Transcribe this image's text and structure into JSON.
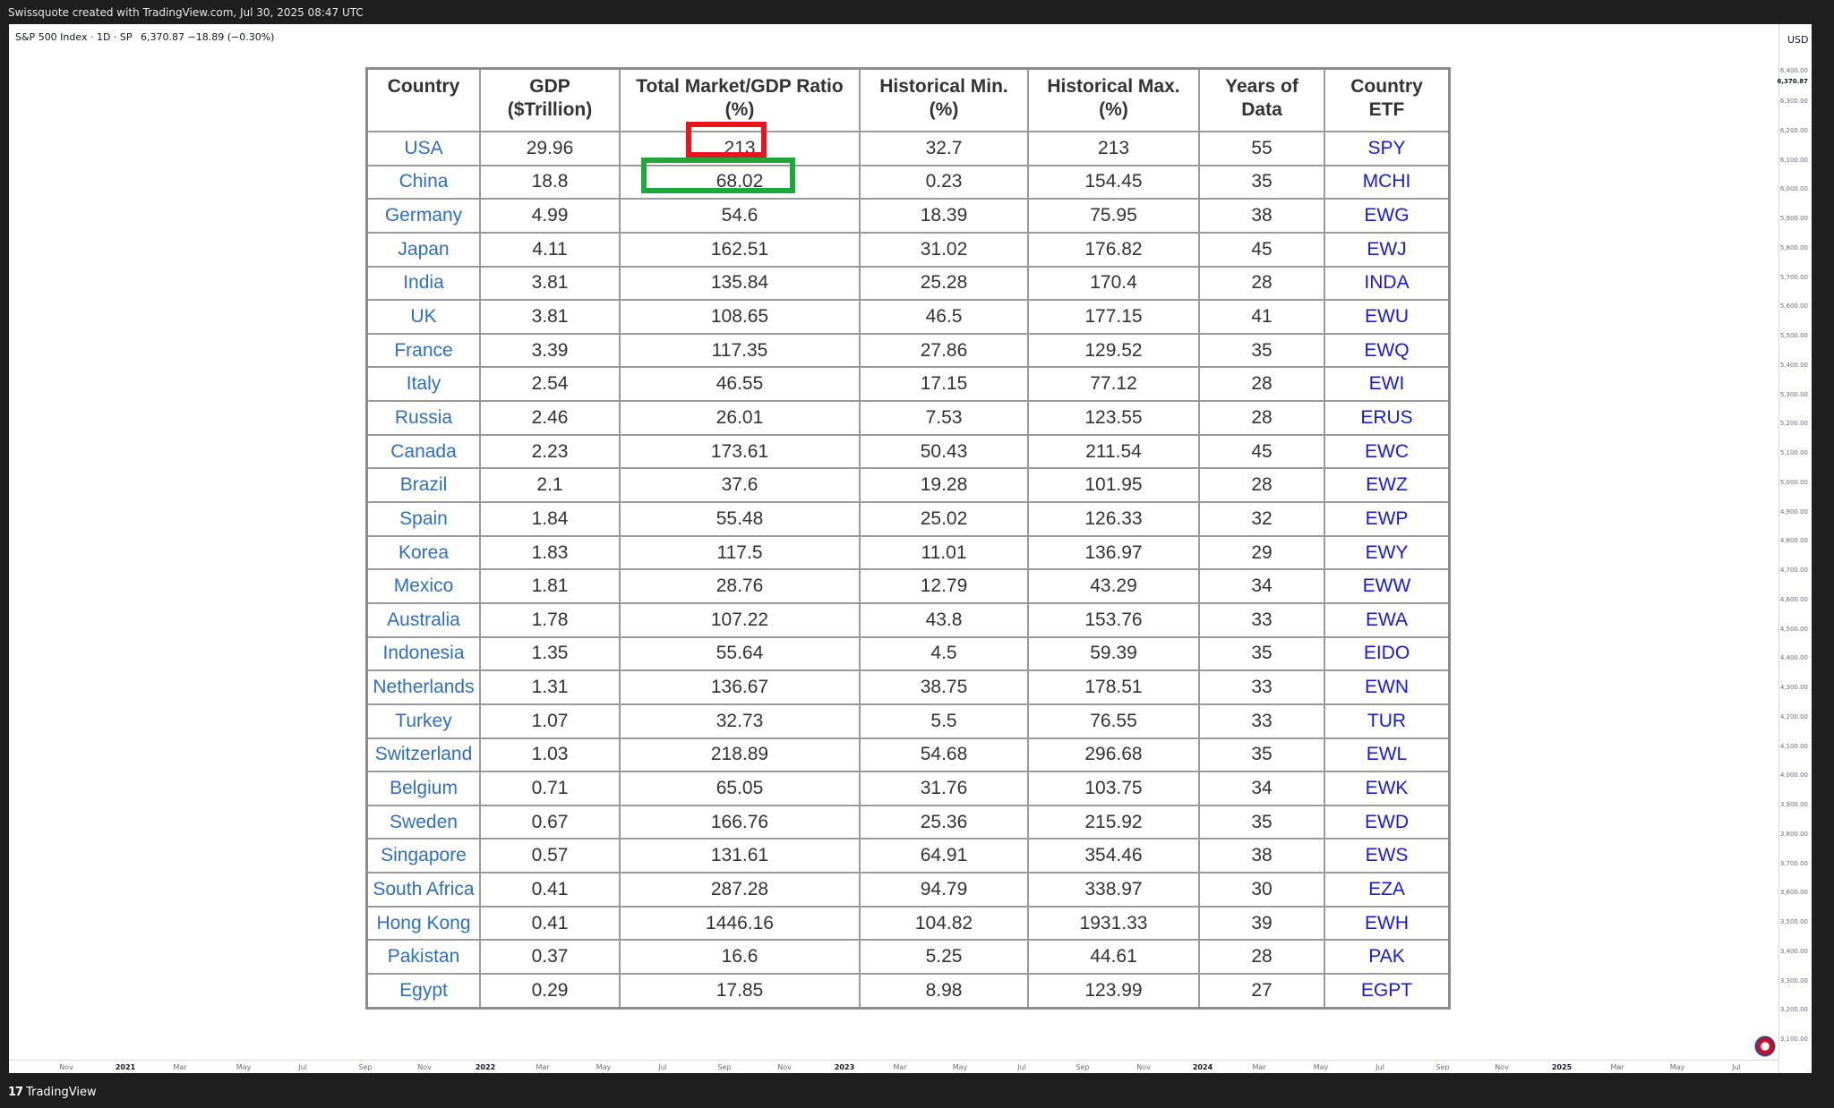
{
  "header": {
    "title": "Swissquote created with TradingView.com, Jul 30, 2025 08:47 UTC"
  },
  "symbol": {
    "name": "S&P 500 Index · 1D · SP",
    "price": "6,370.87",
    "change": "−18.89 (−0.30%)"
  },
  "currency": "USD",
  "price_scale": [
    "6,400.00",
    "6,370.87",
    "6,300.00",
    "6,200.00",
    "6,100.00",
    "6,000.00",
    "5,900.00",
    "5,800.00",
    "5,700.00",
    "5,600.00",
    "5,500.00",
    "5,400.00",
    "5,300.00",
    "5,200.00",
    "5,100.00",
    "5,000.00",
    "4,900.00",
    "4,800.00",
    "4,700.00",
    "4,600.00",
    "4,500.00",
    "4,400.00",
    "4,300.00",
    "4,200.00",
    "4,100.00",
    "4,000.00",
    "3,900.00",
    "3,800.00",
    "3,700.00",
    "3,600.00",
    "3,500.00",
    "3,400.00",
    "3,300.00",
    "3,200.00",
    "3,100.00"
  ],
  "time_axis": [
    "Nov",
    "2021",
    "Mar",
    "May",
    "Jul",
    "Sep",
    "Nov",
    "2022",
    "Mar",
    "May",
    "Jul",
    "Sep",
    "Nov",
    "2023",
    "Mar",
    "May",
    "Jul",
    "Sep",
    "Nov",
    "2024",
    "Mar",
    "May",
    "Jul",
    "Sep",
    "Nov",
    "2025",
    "Mar",
    "May",
    "Jul"
  ],
  "footer": {
    "brand": "TradingView",
    "brand_mark": "17"
  },
  "table": {
    "headers": [
      [
        "Country"
      ],
      [
        "GDP",
        "($Trillion)"
      ],
      [
        "Total Market/GDP Ratio",
        "(%)"
      ],
      [
        "Historical Min.",
        "(%)"
      ],
      [
        "Historical Max.",
        "(%)"
      ],
      [
        "Years of",
        "Data"
      ],
      [
        "Country",
        "ETF"
      ]
    ],
    "rows": [
      [
        "USA",
        "29.96",
        "213",
        "32.7",
        "213",
        "55",
        "SPY"
      ],
      [
        "China",
        "18.8",
        "68.02",
        "0.23",
        "154.45",
        "35",
        "MCHI"
      ],
      [
        "Germany",
        "4.99",
        "54.6",
        "18.39",
        "75.95",
        "38",
        "EWG"
      ],
      [
        "Japan",
        "4.11",
        "162.51",
        "31.02",
        "176.82",
        "45",
        "EWJ"
      ],
      [
        "India",
        "3.81",
        "135.84",
        "25.28",
        "170.4",
        "28",
        "INDA"
      ],
      [
        "UK",
        "3.81",
        "108.65",
        "46.5",
        "177.15",
        "41",
        "EWU"
      ],
      [
        "France",
        "3.39",
        "117.35",
        "27.86",
        "129.52",
        "35",
        "EWQ"
      ],
      [
        "Italy",
        "2.54",
        "46.55",
        "17.15",
        "77.12",
        "28",
        "EWI"
      ],
      [
        "Russia",
        "2.46",
        "26.01",
        "7.53",
        "123.55",
        "28",
        "ERUS"
      ],
      [
        "Canada",
        "2.23",
        "173.61",
        "50.43",
        "211.54",
        "45",
        "EWC"
      ],
      [
        "Brazil",
        "2.1",
        "37.6",
        "19.28",
        "101.95",
        "28",
        "EWZ"
      ],
      [
        "Spain",
        "1.84",
        "55.48",
        "25.02",
        "126.33",
        "32",
        "EWP"
      ],
      [
        "Korea",
        "1.83",
        "117.5",
        "11.01",
        "136.97",
        "29",
        "EWY"
      ],
      [
        "Mexico",
        "1.81",
        "28.76",
        "12.79",
        "43.29",
        "34",
        "EWW"
      ],
      [
        "Australia",
        "1.78",
        "107.22",
        "43.8",
        "153.76",
        "33",
        "EWA"
      ],
      [
        "Indonesia",
        "1.35",
        "55.64",
        "4.5",
        "59.39",
        "35",
        "EIDO"
      ],
      [
        "Netherlands",
        "1.31",
        "136.67",
        "38.75",
        "178.51",
        "33",
        "EWN"
      ],
      [
        "Turkey",
        "1.07",
        "32.73",
        "5.5",
        "76.55",
        "33",
        "TUR"
      ],
      [
        "Switzerland",
        "1.03",
        "218.89",
        "54.68",
        "296.68",
        "35",
        "EWL"
      ],
      [
        "Belgium",
        "0.71",
        "65.05",
        "31.76",
        "103.75",
        "34",
        "EWK"
      ],
      [
        "Sweden",
        "0.67",
        "166.76",
        "25.36",
        "215.92",
        "35",
        "EWD"
      ],
      [
        "Singapore",
        "0.57",
        "131.61",
        "64.91",
        "354.46",
        "38",
        "EWS"
      ],
      [
        "South Africa",
        "0.41",
        "287.28",
        "94.79",
        "338.97",
        "30",
        "EZA"
      ],
      [
        "Hong Kong",
        "0.41",
        "1446.16",
        "104.82",
        "1931.33",
        "39",
        "EWH"
      ],
      [
        "Pakistan",
        "0.37",
        "16.6",
        "5.25",
        "44.61",
        "28",
        "PAK"
      ],
      [
        "Egypt",
        "0.29",
        "17.85",
        "8.98",
        "123.99",
        "27",
        "EGPT"
      ]
    ]
  },
  "highlights": [
    {
      "cell": "USA / Total Market/GDP Ratio",
      "color": "#e8141e"
    },
    {
      "cell": "China / Total Market/GDP Ratio",
      "color": "#1fa83a"
    }
  ],
  "colors": {
    "country_link": "#2f6fbf",
    "etf_link": "#1a1ad6",
    "highlight_red": "#e8141e",
    "highlight_green": "#1fa83a"
  }
}
